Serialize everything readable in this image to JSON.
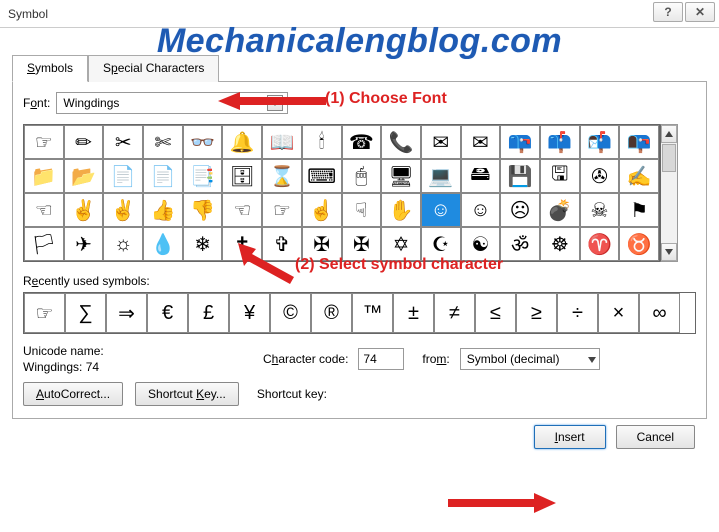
{
  "title": "Symbol",
  "watermark": "Mechanicalengblog.com",
  "tabs": {
    "symbols": "Symbols",
    "special": "Special Characters"
  },
  "font_label_pre": "F",
  "font_label_u": "o",
  "font_label_post": "nt:",
  "font_value": "Wingdings",
  "symbols": [
    [
      "☞",
      "✏",
      "✂",
      "✄",
      "👓",
      "🔔",
      "📖",
      "🕯",
      "☎",
      "📞",
      "✉",
      "✉",
      "📪",
      "📫",
      "📬",
      "📭"
    ],
    [
      "📁",
      "📂",
      "📄",
      "📄",
      "📑",
      "🗄",
      "⌛",
      "⌨",
      "🖱",
      "🖥",
      "💻",
      "🖴",
      "💾",
      "🖫",
      "✇",
      "✍"
    ],
    [
      "☜",
      "✌",
      "✌",
      "👍",
      "👎",
      "☜",
      "☞",
      "☝",
      "☟",
      "✋",
      "☺",
      "☺",
      "☹",
      "💣",
      "☠",
      "⚑"
    ],
    [
      "🏳",
      "✈",
      "☼",
      "💧",
      "❄",
      "✝",
      "✞",
      "✠",
      "✠",
      "✡",
      "☪",
      "☯",
      "ॐ",
      "☸",
      "♈",
      "♉"
    ]
  ],
  "selected_index": [
    2,
    10
  ],
  "recent_label_pre": "R",
  "recent_label_u": "e",
  "recent_label_post": "cently used symbols:",
  "recent": [
    "☞",
    "∑",
    "⇒",
    "€",
    "£",
    "¥",
    "©",
    "®",
    "™",
    "±",
    "≠",
    "≤",
    "≥",
    "÷",
    "×",
    "∞"
  ],
  "unicode_name_label": "Unicode name:",
  "unicode_name_value": "Wingdings: 74",
  "charcode_label_pre": "C",
  "charcode_label_u": "h",
  "charcode_label_post": "aracter code:",
  "charcode_value": "74",
  "from_label_pre": "fro",
  "from_label_u": "m",
  "from_label_post": ":",
  "from_value": "Symbol (decimal)",
  "autocorrect_label": "AutoCorrect...",
  "shortcutkey_label": "Shortcut Key...",
  "shortcut_static": "Shortcut key:",
  "insert_label": "Insert",
  "cancel_label": "Cancel",
  "anno1": "(1) Choose Font",
  "anno2": "(2) Select symbol character"
}
